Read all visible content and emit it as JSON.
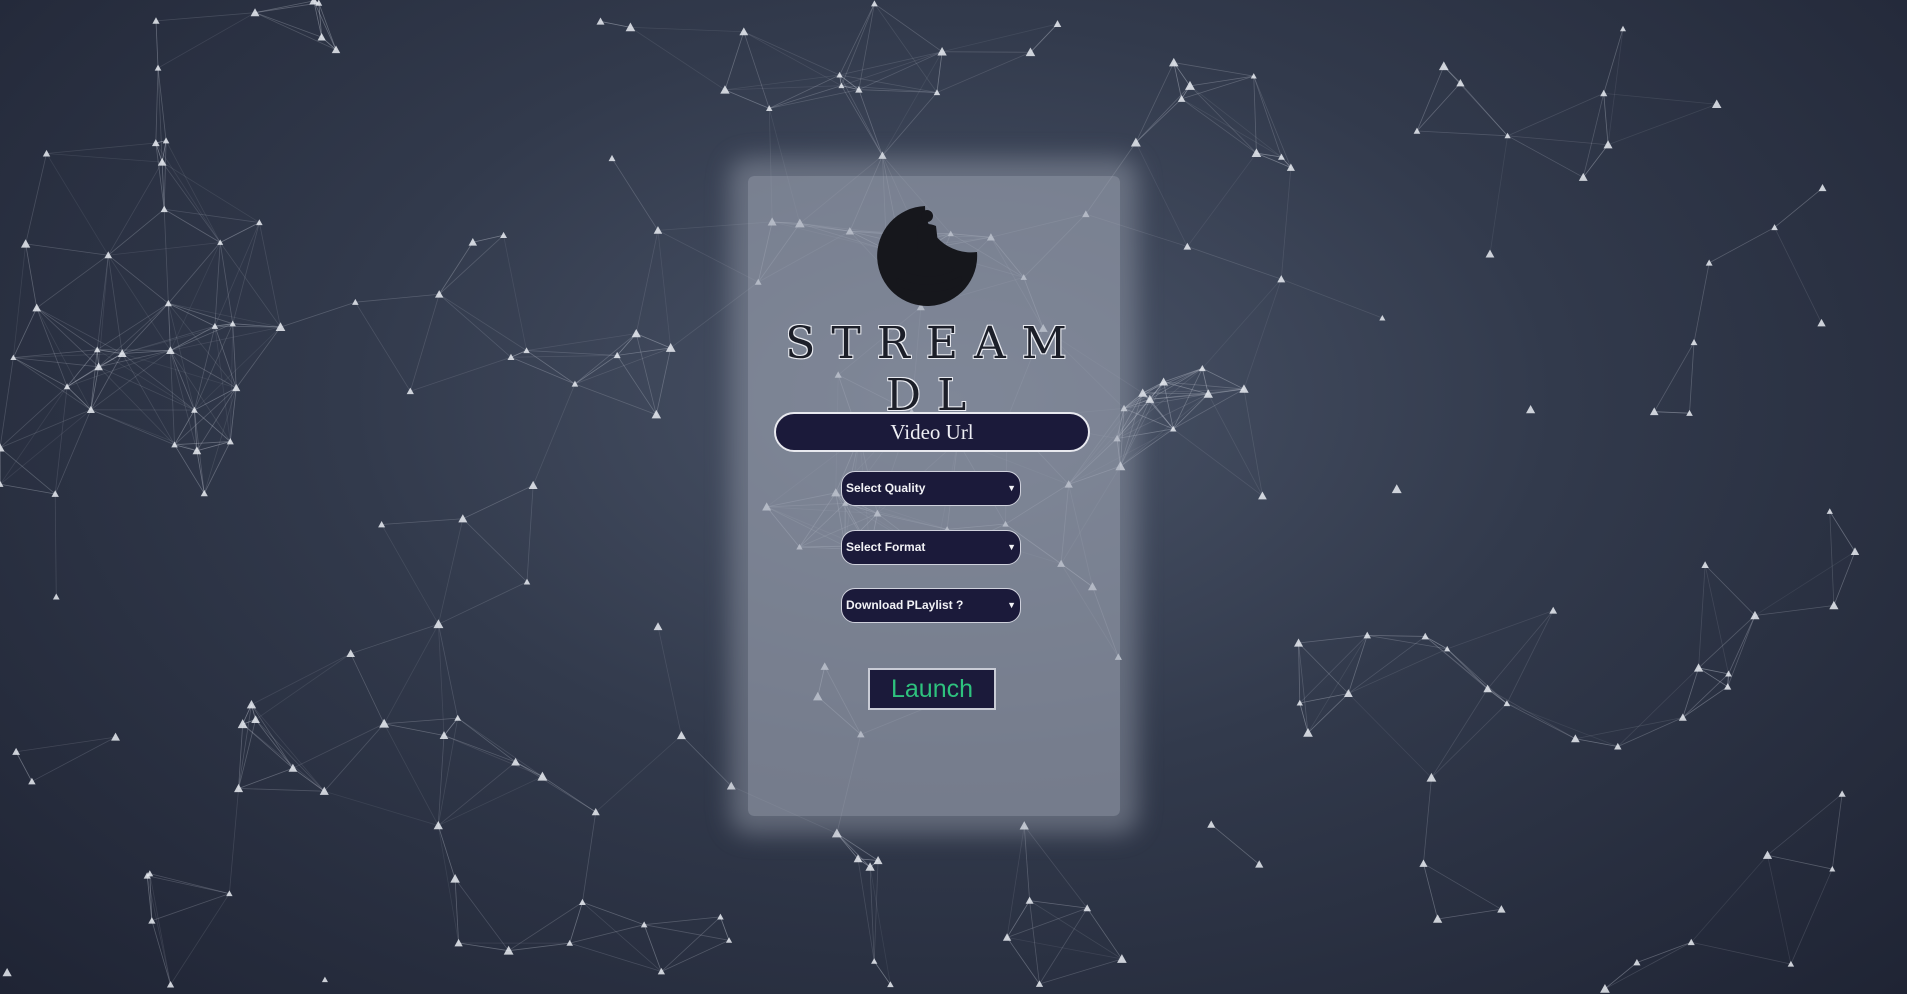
{
  "brand": {
    "title": "STREAM DL",
    "logo_icon": "meditating-figure-icon"
  },
  "form": {
    "url_placeholder": "Video Url",
    "quality_label": "Select Quality",
    "format_label": "Select Format",
    "playlist_label": "Download PLaylist ?",
    "dropdown_arrow": "▼",
    "launch_label": "Launch"
  },
  "colors": {
    "background": "#323a4c",
    "panel": "#a0a6b4",
    "control_bg": "#1b1a3a",
    "launch_text": "#2ec27e",
    "network_lines": "#c7ccd8"
  }
}
